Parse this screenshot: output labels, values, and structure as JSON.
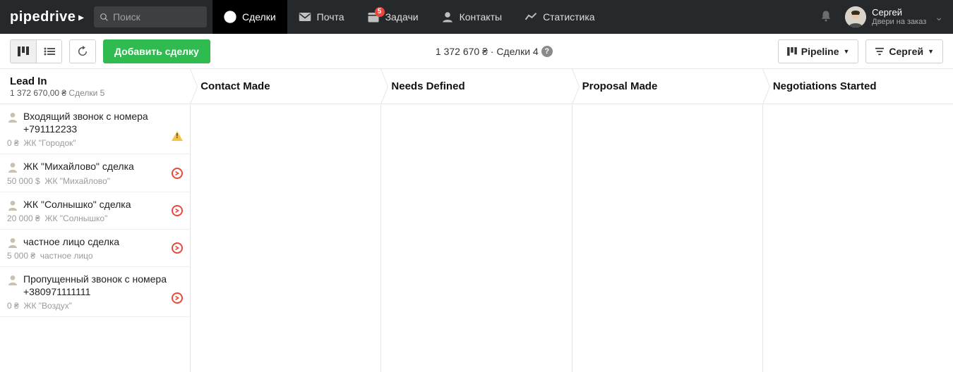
{
  "brand": "pipedrive",
  "search": {
    "placeholder": "Поиск"
  },
  "nav": {
    "deals": "Сделки",
    "mail": "Почта",
    "tasks": "Задачи",
    "tasks_badge": "5",
    "contacts": "Контакты",
    "stats": "Статистика"
  },
  "user": {
    "name": "Сергей",
    "sub": "Двери на заказ"
  },
  "toolbar": {
    "add_deal": "Добавить сделку",
    "summary": "1 372 670 ₴ · Сделки 4",
    "pipeline_label": "Pipeline",
    "filter_user": "Сергей"
  },
  "stages": [
    {
      "title": "Lead In",
      "amount": "1 372 670,00 ₴",
      "count_label": "Сделки 5"
    },
    {
      "title": "Contact Made"
    },
    {
      "title": "Needs Defined"
    },
    {
      "title": "Proposal Made"
    },
    {
      "title": "Negotiations Started"
    }
  ],
  "leadin_cards": [
    {
      "title": "Входящий звонок с номера +791112233",
      "value": "0 ₴",
      "org": "ЖК \"Городок\"",
      "status": "warn"
    },
    {
      "title": "ЖК \"Михайлово\" сделка",
      "value": "50 000 $",
      "org": "ЖК \"Михайлово\"",
      "status": "over"
    },
    {
      "title": "ЖК \"Солнышко\" сделка",
      "value": "20 000 ₴",
      "org": "ЖК \"Солнышко\"",
      "status": "over"
    },
    {
      "title": "частное лицо сделка",
      "value": "5 000 ₴",
      "org": "частное лицо",
      "status": "over"
    },
    {
      "title": "Пропущенный звонок с номера +380971111111",
      "value": "0 ₴",
      "org": "ЖК \"Воздух\"",
      "status": "over"
    }
  ]
}
